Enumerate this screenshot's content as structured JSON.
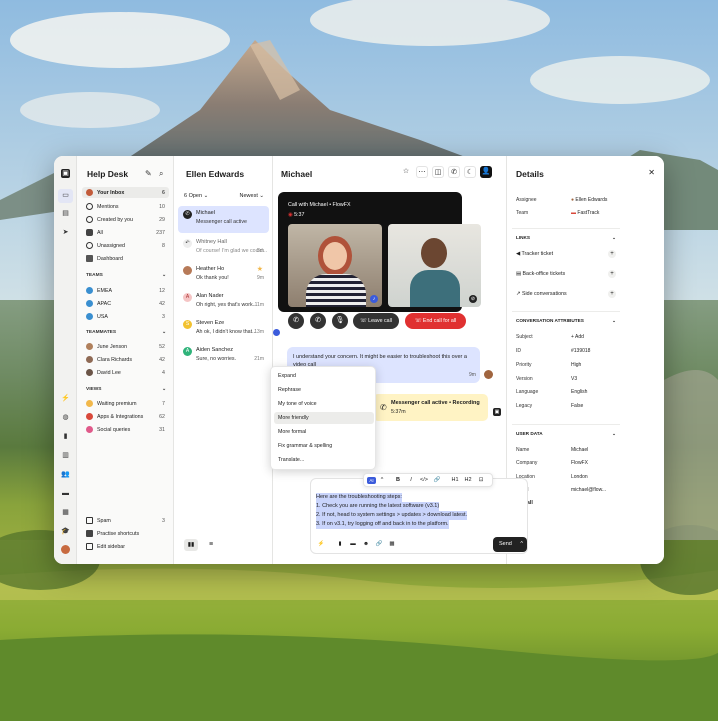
{
  "sidebar": {
    "title": "Help Desk",
    "items": [
      {
        "label": "Your Inbox",
        "count": "6"
      },
      {
        "label": "Mentions",
        "count": "10"
      },
      {
        "label": "Created by you",
        "count": "29"
      },
      {
        "label": "All",
        "count": "237"
      },
      {
        "label": "Unassigned",
        "count": "8"
      },
      {
        "label": "Dashboard",
        "count": ""
      }
    ],
    "teams_label": "TEAMS",
    "teams": [
      {
        "label": "EMEA",
        "count": "12"
      },
      {
        "label": "APAC",
        "count": "42"
      },
      {
        "label": "USA",
        "count": "3"
      }
    ],
    "teammates_label": "TEAMMATES",
    "teammates": [
      {
        "label": "June Jenson",
        "count": "52"
      },
      {
        "label": "Clara Richards",
        "count": "42"
      },
      {
        "label": "David Lee",
        "count": "4"
      }
    ],
    "views_label": "VIEWS",
    "views": [
      {
        "label": "Waiting premium",
        "count": "7"
      },
      {
        "label": "Apps & Integrations",
        "count": "62"
      },
      {
        "label": "Social queries",
        "count": "31"
      }
    ],
    "bottom": [
      {
        "label": "Spam",
        "count": "3"
      },
      {
        "label": "Practise shortcuts",
        "count": ""
      },
      {
        "label": "Edit sidebar",
        "count": ""
      }
    ]
  },
  "list": {
    "title": "Ellen Edwards",
    "filter": "6 Open",
    "sort": "Newest",
    "conversations": [
      {
        "name": "Michael",
        "preview": "Messenger call active",
        "time": ""
      },
      {
        "name": "Whitney Hall",
        "preview": "Of course! I'm glad we could...",
        "time": "5m"
      },
      {
        "name": "Heather Ho",
        "preview": "Ok thank you!",
        "time": "9m"
      },
      {
        "name": "Alan Nader",
        "preview": "Oh right, yes that's work...",
        "time": "11m"
      },
      {
        "name": "Steven Eze",
        "preview": "Ah ok, I didn't know that...",
        "time": "13m"
      },
      {
        "name": "Aiden Sanchez",
        "preview": "Sure, no worries.",
        "time": "21m"
      }
    ]
  },
  "conversation": {
    "title": "Michael",
    "call": {
      "title": "Call with Michael • FlowFX",
      "timer": "5:37",
      "leave": "Leave call",
      "end": "End call for all"
    },
    "message": {
      "text": "I understand your concern. It might be easier to troubleshoot this over a video call",
      "time": "9m"
    },
    "call_status": {
      "label": "Messenger call active • Recording",
      "time": "5:37m"
    },
    "ai_menu": [
      "Expand",
      "Rephrase",
      "My tone of voice",
      "More friendly",
      "More formal",
      "Fix grammar & spelling",
      "Translate..."
    ],
    "composer": {
      "ai_label": "AI",
      "lines": [
        "Here are the troubleshooting steps:",
        "1. Check you are running the latest software (v3.1)",
        "2. If not, head to system settings > updates > download latest.",
        "3. If on v3.1, try logging off and back in to the platform."
      ],
      "send": "Send"
    }
  },
  "details": {
    "title": "Details",
    "assignee_label": "Assignee",
    "assignee": "Ellen Edwards",
    "team_label": "Team",
    "team": "FastTrack",
    "links_label": "LINKS",
    "links": [
      "Tracker ticket",
      "Back-office tickets",
      "Side conversations"
    ],
    "attributes_label": "CONVERSATION ATTRIBUTES",
    "attributes": [
      {
        "k": "Subject",
        "v": "+ Add"
      },
      {
        "k": "ID",
        "v": "#139018"
      },
      {
        "k": "Priority",
        "v": "High"
      },
      {
        "k": "Version",
        "v": "V3"
      },
      {
        "k": "Language",
        "v": "English"
      },
      {
        "k": "Legacy",
        "v": "False"
      }
    ],
    "user_label": "USER DATA",
    "user": [
      {
        "k": "Name",
        "v": "Michael"
      },
      {
        "k": "Company",
        "v": "FlowFX"
      },
      {
        "k": "Location",
        "v": "London"
      },
      {
        "k": "Email",
        "v": "michael@flow..."
      }
    ],
    "see_all": "See all"
  },
  "colors": {
    "accent": "#3b5bdb",
    "end_call": "#e03131",
    "selected": "#dde4ff",
    "call_bg": "#111111",
    "status_bg": "#fff3c4"
  }
}
